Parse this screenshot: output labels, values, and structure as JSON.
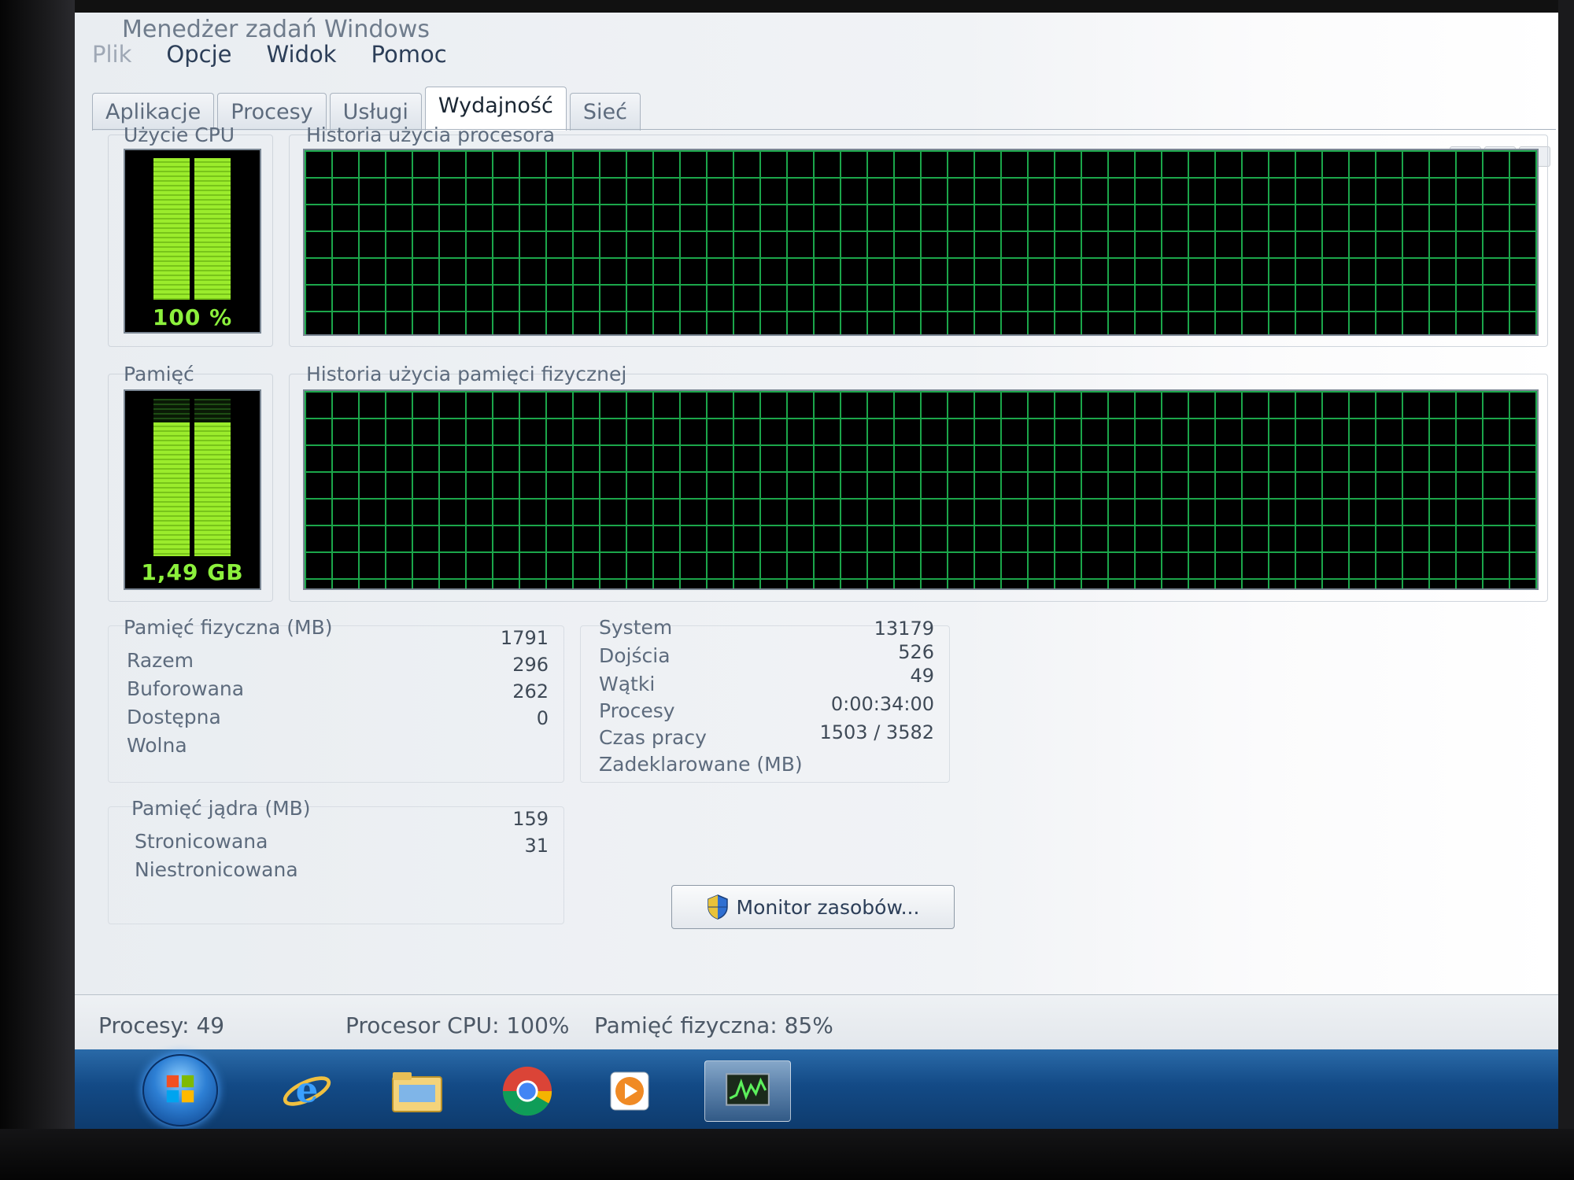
{
  "window": {
    "title": "Menedżer zadań Windows"
  },
  "menu": [
    "Plik",
    "Opcje",
    "Widok",
    "Pomoc"
  ],
  "tabs": [
    {
      "label": "Aplikacje",
      "active": false
    },
    {
      "label": "Procesy",
      "active": false
    },
    {
      "label": "Usługi",
      "active": false
    },
    {
      "label": "Wydajność",
      "active": true
    },
    {
      "label": "Sieć",
      "active": false
    }
  ],
  "cpu": {
    "label": "Użycie CPU",
    "value_text": "100 %",
    "usage_percent": 100,
    "history_label": "Historia użycia procesora"
  },
  "memory": {
    "label": "Pamięć",
    "value_text": "1,49 GB",
    "usage_fraction": 0.85,
    "history_label": "Historia użycia pamięci fizycznej"
  },
  "physical_memory": {
    "title": "Pamięć fizyczna (MB)",
    "rows": [
      {
        "label": "Razem",
        "value": "1791"
      },
      {
        "label": "Buforowana",
        "value": "296"
      },
      {
        "label": "Dostępna",
        "value": "262"
      },
      {
        "label": "Wolna",
        "value": "0"
      }
    ]
  },
  "kernel_memory": {
    "title": "Pamięć jądra (MB)",
    "rows": [
      {
        "label": "Stronicowana",
        "value": "159"
      },
      {
        "label": "Niestronicowana",
        "value": "31"
      }
    ]
  },
  "system": {
    "title": "System",
    "rows": [
      {
        "label": "Dojścia",
        "value": "13179"
      },
      {
        "label": "Wątki",
        "value": "526"
      },
      {
        "label": "Procesy",
        "value": "49"
      },
      {
        "label": "Czas pracy",
        "value": "0:00:34:00"
      },
      {
        "label": "Zadeklarowane (MB)",
        "value": "1503 / 3582"
      }
    ]
  },
  "monitor_button": {
    "label": "Monitor zasobów..."
  },
  "statusbar": {
    "processes": "Procesy: 49",
    "cpu": "Procesor CPU: 100%",
    "memory": "Pamięć fizyczna: 85%"
  },
  "taskbar": {
    "icons": [
      "start-orb",
      "internet-explorer-icon",
      "explorer-folder-icon",
      "chrome-icon",
      "media-player-icon",
      "task-manager-icon"
    ]
  }
}
